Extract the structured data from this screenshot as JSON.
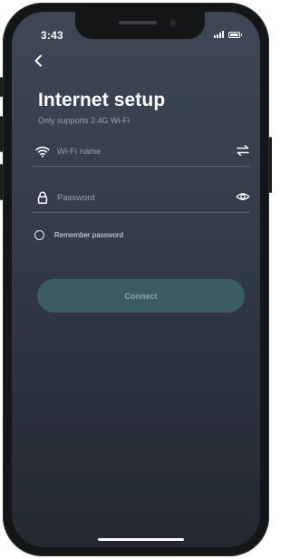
{
  "status_bar": {
    "time": "3:43"
  },
  "header": {
    "back_icon": "chevron-left-icon"
  },
  "page": {
    "title": "Internet setup",
    "subtitle": "Only supports 2.4G Wi-Fi"
  },
  "wifi_field": {
    "icon": "wifi-icon",
    "placeholder": "Wi-Fi name",
    "value": "",
    "action_icon": "swap-arrows-icon"
  },
  "password_field": {
    "icon": "lock-icon",
    "placeholder": "Password",
    "value": "",
    "action_icon": "eye-icon"
  },
  "remember": {
    "label": "Remember password",
    "checked": false
  },
  "connect_button": {
    "label": "Connect",
    "enabled": false
  },
  "colors": {
    "background_top": "#3e4756",
    "background_bottom": "#232830",
    "button_disabled": "#3b5c63",
    "button_text_disabled": "#8ea5aa"
  }
}
